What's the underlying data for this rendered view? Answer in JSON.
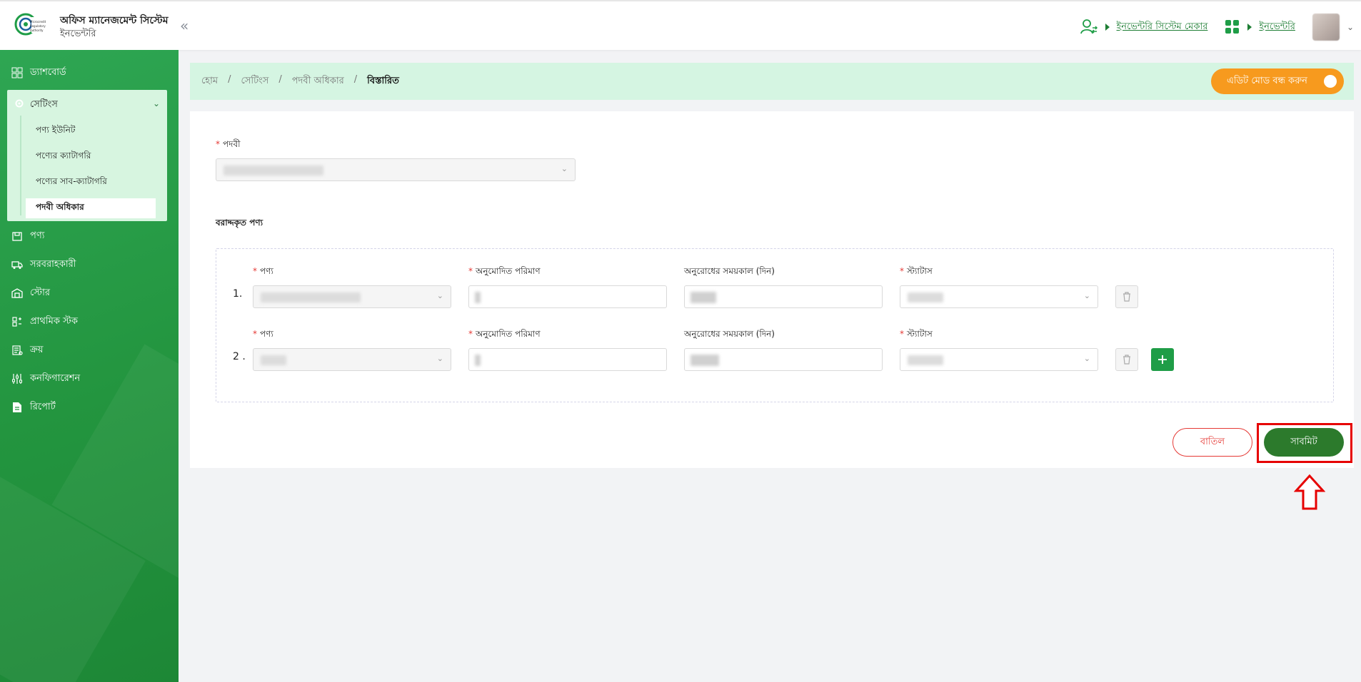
{
  "header": {
    "brand_title": "অফিস ম্যানেজমেন্ট সিস্টেম",
    "brand_sub": "ইনভেন্টরি",
    "user_role_link": "ইনভেন্টরি সিস্টেম মেকার",
    "module_link": "ইনভেন্টরি",
    "collapse_icon": "«"
  },
  "sidebar": {
    "dashboard": "ড্যাশবোর্ড",
    "settings": "সেটিংস",
    "settings_items": [
      "পণ্য ইউনিট",
      "পণ্যের ক্যাটাগরি",
      "পণ্যের সাব-ক্যাটাগরি",
      "পদবী অধিকার"
    ],
    "product": "পণ্য",
    "supplier": "সরবরাহকারী",
    "store": "স্টোর",
    "initial_stock": "প্রাথমিক স্টক",
    "purchase": "ক্রয়",
    "configuration": "কনফিগারেশন",
    "report": "রিপোর্ট"
  },
  "breadcrumb": {
    "items": [
      "হোম",
      "সেটিংস",
      "পদবী অধিকার"
    ],
    "current": "বিস্তারিত",
    "separator": "/"
  },
  "edit_toggle": {
    "label": "এডিট মোড বন্ধ করুন"
  },
  "form": {
    "designation_label": "পদবী",
    "allocated_products_title": "বরাদ্দকৃত পণ্য",
    "rows": [
      {
        "num": "1.",
        "product_label": "পণ্য",
        "approved_qty_label": "অনুমোদিত পরিমাণ",
        "request_period_label": "অনুরোধের সময়কাল (দিন)",
        "status_label": "স্ট্যাটাস"
      },
      {
        "num": "2 .",
        "product_label": "পণ্য",
        "approved_qty_label": "অনুমোদিত পরিমাণ",
        "request_period_label": "অনুরোধের সময়কাল (দিন)",
        "status_label": "স্ট্যাটাস"
      }
    ],
    "required_mark": "*",
    "cancel_label": "বাতিল",
    "submit_label": "সাবমিট"
  },
  "colors": {
    "brand_green": "#1f9d47",
    "sidebar_green": "#23953f",
    "submit_green": "#2c7a2c",
    "toggle_orange": "#f79a1e",
    "highlight_red": "#e60000"
  },
  "icons": [
    "logo-icon",
    "collapse-icon",
    "user-switch-icon",
    "apps-grid-icon",
    "chevron-down-icon",
    "dashboard-icon",
    "gear-icon",
    "box-icon",
    "truck-icon",
    "store-icon",
    "stock-icon",
    "cart-icon",
    "sliders-icon",
    "report-icon",
    "trash-icon",
    "plus-icon",
    "arrow-up-icon"
  ]
}
